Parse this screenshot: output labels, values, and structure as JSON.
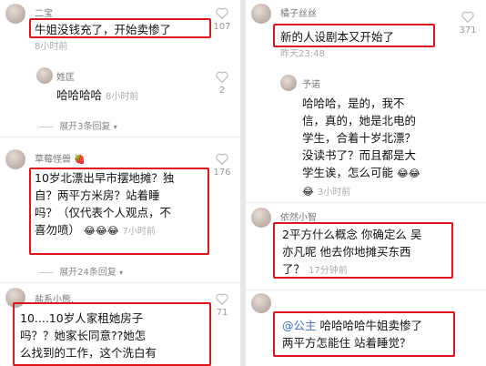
{
  "left": {
    "c1": {
      "user": "二宝",
      "text": "牛姐没钱充了，开始卖惨了",
      "time": "8小时前",
      "likes": "107"
    },
    "c1_reply": {
      "user": "姓匡",
      "text": "哈哈哈哈",
      "time": "8小时前",
      "likes": "2"
    },
    "c1_expand": "展开3条回复",
    "c2": {
      "user": "草莓怪兽",
      "text_lines": [
        "10岁北漂出早市摆地摊？独",
        "自？两平方米房？站着睡",
        "吗？（仅代表个人观点，不",
        "喜勿喷）"
      ],
      "emoji": "😂😂😂",
      "time": "7小时前",
      "likes": "176"
    },
    "c2_expand": "展开24条回复",
    "c3": {
      "user": "盐系小熊.",
      "text_lines": [
        "10....10岁人家租她房子",
        "吗？？她家长同意??她怎",
        "么找到的工作，这个洗白有"
      ],
      "likes": "71"
    }
  },
  "right": {
    "c1": {
      "user": "橘子丝丝",
      "text": "新的人设剧本又开始了",
      "time": "昨天23:48",
      "likes": "371"
    },
    "c1_reply": {
      "user": "予诺",
      "text_lines": [
        "哈哈哈，是的，我不",
        "信，真的，她是北电的",
        "学生，合着十岁北漂？",
        "没读书了？而且都是大",
        "学生诶，怎么可能"
      ],
      "emoji": "😂😂",
      "time_emoji": "😂",
      "time": "3小时前"
    },
    "c2": {
      "user": "依然小智",
      "text_lines": [
        "2平方什么概念 你确定么 吴",
        "亦凡呢 他去你地摊买东西",
        "了？"
      ],
      "time": "17分钟前"
    },
    "c3": {
      "user": "",
      "mention": "@公主",
      "text_lines": [
        "哈哈哈哈牛姐卖惨了",
        "两平方怎能住 站着睡觉？"
      ]
    }
  },
  "colors": {
    "highlight": "#e0151b",
    "mention": "#3a6fc2"
  },
  "icons": {
    "like": "heart-icon",
    "expand": "chevron-down-icon"
  }
}
